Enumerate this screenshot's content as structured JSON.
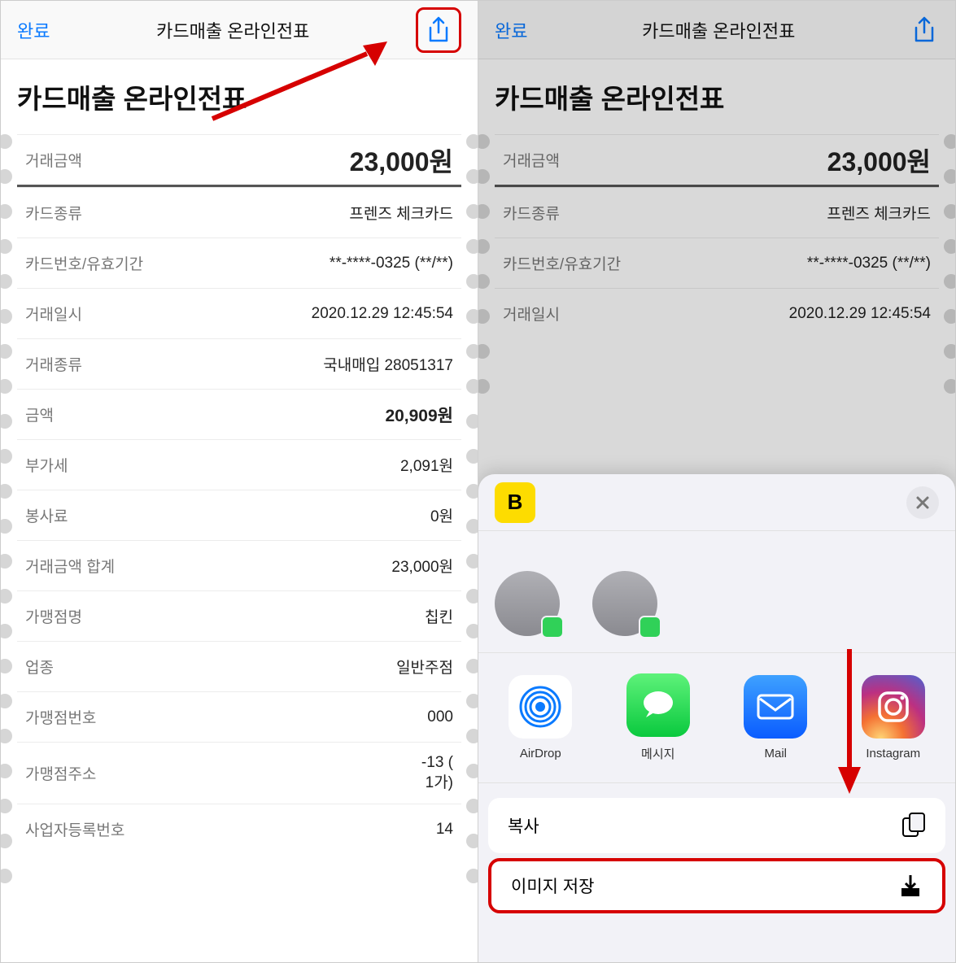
{
  "left": {
    "nav": {
      "done": "완료",
      "title": "카드매출 온라인전표"
    },
    "page_title": "카드매출 온라인전표",
    "amount": {
      "label": "거래금액",
      "value": "23,000원"
    },
    "rows": [
      {
        "label": "카드종류",
        "value": "프렌즈 체크카드"
      },
      {
        "label": "카드번호/유효기간",
        "value": "**-****-0325 (**/**)"
      },
      {
        "label": "거래일시",
        "value": "2020.12.29 12:45:54"
      },
      {
        "label": "거래종류",
        "value": "국내매입 28051317"
      },
      {
        "label": "금액",
        "value": "20,909원",
        "bold": true
      },
      {
        "label": "부가세",
        "value": "2,091원"
      },
      {
        "label": "봉사료",
        "value": "0원"
      },
      {
        "label": "거래금액 합계",
        "value": "23,000원"
      },
      {
        "label": "가맹점명",
        "value": "칩킨"
      },
      {
        "label": "업종",
        "value": "일반주점"
      },
      {
        "label": "가맹점번호",
        "value": "000"
      },
      {
        "label": "가맹점주소",
        "value": "-13 (\n1가)"
      },
      {
        "label": "사업자등록번호",
        "value": "14"
      }
    ]
  },
  "right": {
    "nav": {
      "done": "완료",
      "title": "카드매출 온라인전표"
    },
    "page_title": "카드매출 온라인전표",
    "amount": {
      "label": "거래금액",
      "value": "23,000원"
    },
    "rows": [
      {
        "label": "카드종류",
        "value": "프렌즈 체크카드"
      },
      {
        "label": "카드번호/유효기간",
        "value": "**-****-0325 (**/**)"
      },
      {
        "label": "거래일시",
        "value": "2020.12.29 12:45:54"
      }
    ],
    "share_sheet": {
      "app_icon_letter": "B",
      "apps": [
        {
          "name": "AirDrop",
          "label": "AirDrop"
        },
        {
          "name": "Messages",
          "label": "메시지"
        },
        {
          "name": "Mail",
          "label": "Mail"
        },
        {
          "name": "Instagram",
          "label": "Instagram"
        }
      ],
      "actions": {
        "copy": "복사",
        "save_image": "이미지 저장"
      }
    }
  }
}
